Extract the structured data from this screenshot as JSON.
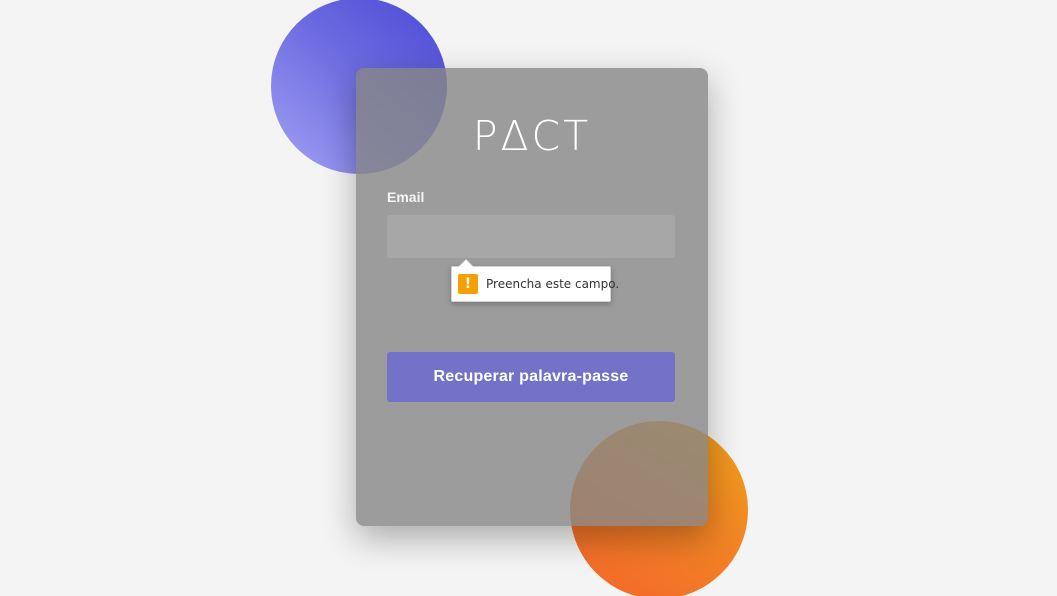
{
  "app": {
    "logo_text": "PΔCT"
  },
  "form": {
    "email_label": "Email",
    "email_value": "",
    "email_placeholder": "",
    "recover_label": "Recuperar palavra-passe"
  },
  "validation_tooltip": {
    "icon": "warning-icon",
    "icon_glyph": "!",
    "message": "Preencha este campo."
  },
  "colors": {
    "page_background": "#f4f4f4",
    "card_background": "#8a8a8a",
    "button_background": "#7471c8",
    "blue_circle": "#5a58dc",
    "orange_circle": "#f28524",
    "warning": "#f59f00"
  }
}
